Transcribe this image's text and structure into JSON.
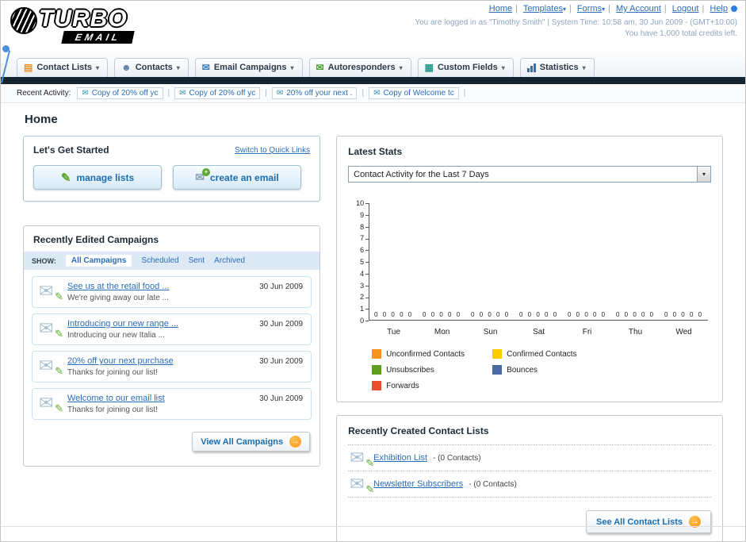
{
  "colors": {
    "accent_orange": "#f7941d",
    "link_blue": "#2a6db8",
    "dark_bar": "#16242f"
  },
  "icons": {
    "dropdown_arrow": "▾",
    "envelope": "✉",
    "pencil": "✎",
    "arrow_right": "→",
    "plus": "+",
    "list": "▤",
    "person": "☻",
    "grid": "▦"
  },
  "header": {
    "logo_primary": "TURBO",
    "logo_secondary": "EMAIL",
    "top_links": [
      {
        "label": "Home",
        "dropdown": false
      },
      {
        "label": "Templates",
        "dropdown": true
      },
      {
        "label": "Forms",
        "dropdown": true
      },
      {
        "label": "My Account",
        "dropdown": false
      },
      {
        "label": "Logout",
        "dropdown": false
      },
      {
        "label": "Help",
        "dropdown": false
      }
    ],
    "session_text": "You are logged in as \"Timothy Smith\" | System Time: 10:58 am, 30 Jun 2009 - (GMT+10:00)",
    "credits_text": "You have 1,000 total credits left."
  },
  "nav": {
    "items": [
      {
        "label": "Contact Lists"
      },
      {
        "label": "Contacts"
      },
      {
        "label": "Email Campaigns"
      },
      {
        "label": "Autoresponders"
      },
      {
        "label": "Custom Fields"
      },
      {
        "label": "Statistics"
      }
    ]
  },
  "recent_activity": {
    "label": "Recent Activity:",
    "items": [
      "Copy of 20% off yc",
      "Copy of 20% off yc",
      "20% off your next .",
      "Copy of Welcome tc"
    ]
  },
  "page_title": "Home",
  "get_started": {
    "title": "Let's Get Started",
    "switch_link": "Switch to Quick Links",
    "manage_label": "manage lists",
    "create_label": "create an email"
  },
  "campaigns": {
    "title": "Recently Edited Campaigns",
    "show_label": "SHOW:",
    "tabs": [
      "All Campaigns",
      "Scheduled",
      "Sent",
      "Archived"
    ],
    "items": [
      {
        "title": "See us at the retail food ...",
        "subtitle": "We're giving away our late ...",
        "date": "30 Jun 2009"
      },
      {
        "title": "Introducing our new range ...",
        "subtitle": "Introducing our new Italia ...",
        "date": "30 Jun 2009"
      },
      {
        "title": "20% off your next purchase",
        "subtitle": "Thanks for joining our list!",
        "date": "30 Jun 2009"
      },
      {
        "title": "Welcome to our email list",
        "subtitle": "Thanks for joining our list!",
        "date": "30 Jun 2009"
      }
    ],
    "view_all_label": "View All Campaigns"
  },
  "stats": {
    "title": "Latest Stats",
    "dropdown_value": "Contact Activity for the Last 7 Days",
    "chart_data": {
      "type": "bar",
      "title": "Contact Activity for the Last 7 Days",
      "categories": [
        "Tue",
        "Mon",
        "Sun",
        "Sat",
        "Fri",
        "Thu",
        "Wed"
      ],
      "series": [
        {
          "name": "Unconfirmed Contacts",
          "color": "#f7941d",
          "values": [
            0,
            0,
            0,
            0,
            0,
            0,
            0
          ]
        },
        {
          "name": "Confirmed Contacts",
          "color": "#ffcc00",
          "values": [
            0,
            0,
            0,
            0,
            0,
            0,
            0
          ]
        },
        {
          "name": "Unsubscribes",
          "color": "#5f9e1f",
          "values": [
            0,
            0,
            0,
            0,
            0,
            0,
            0
          ]
        },
        {
          "name": "Bounces",
          "color": "#4a69a5",
          "values": [
            0,
            0,
            0,
            0,
            0,
            0,
            0
          ]
        },
        {
          "name": "Forwards",
          "color": "#e8502d",
          "values": [
            0,
            0,
            0,
            0,
            0,
            0,
            0
          ]
        }
      ],
      "ylim": [
        0,
        10
      ],
      "yticks": [
        0,
        1,
        2,
        3,
        4,
        5,
        6,
        7,
        8,
        9,
        10
      ],
      "grid": false,
      "legend_position": "bottom"
    }
  },
  "contact_lists": {
    "title": "Recently Created Contact Lists",
    "items": [
      {
        "name": "Exhibition List",
        "detail": "- (0 Contacts)"
      },
      {
        "name": "Newsletter Subscribers",
        "detail": "- (0 Contacts)"
      }
    ],
    "see_all_label": "See All Contact Lists"
  }
}
